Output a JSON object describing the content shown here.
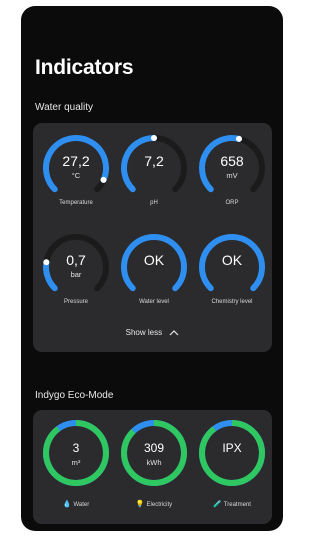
{
  "page": {
    "title": "Indicators"
  },
  "water_quality": {
    "section_title": "Water quality",
    "show_less_label": "Show less",
    "gauges": [
      {
        "value": "27,2",
        "unit": "°C",
        "label": "Temperature",
        "fill": 0.92
      },
      {
        "value": "7,2",
        "unit": "",
        "label": "pH",
        "fill": 0.5
      },
      {
        "value": "658",
        "unit": "mV",
        "label": "ORP",
        "fill": 0.55
      },
      {
        "value": "0,7",
        "unit": "bar",
        "label": "Pressure",
        "fill": 0.2
      },
      {
        "value": "OK",
        "unit": "",
        "label": "Water level",
        "fill": 1.0
      },
      {
        "value": "OK",
        "unit": "",
        "label": "Chemistry level",
        "fill": 1.0
      }
    ]
  },
  "eco_mode": {
    "section_title": "Indygo Eco-Mode",
    "items": [
      {
        "value": "3",
        "unit": "m³",
        "label": "Water",
        "fill": 0.9
      },
      {
        "value": "309",
        "unit": "kWh",
        "label": "Electricity",
        "fill": 0.88
      },
      {
        "value": "IPX",
        "unit": "",
        "label": "Treatment",
        "fill": 0.9
      }
    ]
  },
  "colors": {
    "accent_blue": "#2f8ff0",
    "eco_green": "#2fc760",
    "track_dark": "#1b1b1b",
    "card_bg": "#2b2b2d"
  }
}
